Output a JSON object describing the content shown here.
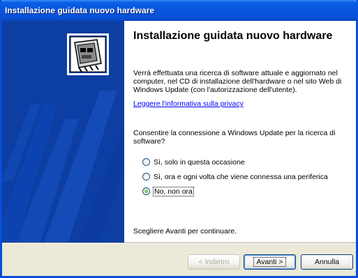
{
  "window": {
    "title": "Installazione guidata nuovo hardware"
  },
  "banner": {
    "icon": "hardware-card-icon",
    "color": "#0d3ea3"
  },
  "content": {
    "heading": "Installazione guidata nuovo hardware",
    "description": "Verrà effettuata una ricerca di software attuale e aggiornato nel computer, nel CD di installazione dell'hardware o nel sito Web di Windows Update (con l'autorizzazione dell'utente).",
    "privacy_link": "Leggere l'informativa sulla privacy",
    "question": "Consentire la connessione a Windows Update per la ricerca di software?",
    "options": [
      {
        "label": "Sì, solo in questa occasione",
        "selected": false
      },
      {
        "label": "Sì, ora e ogni volta che viene connessa una periferica",
        "selected": false
      },
      {
        "label": "No, non ora",
        "selected": true
      }
    ],
    "continue_text": "Scegliere Avanti per continuare."
  },
  "buttons": {
    "back": "< Indietro",
    "next": "Avanti >",
    "cancel": "Annulla"
  }
}
